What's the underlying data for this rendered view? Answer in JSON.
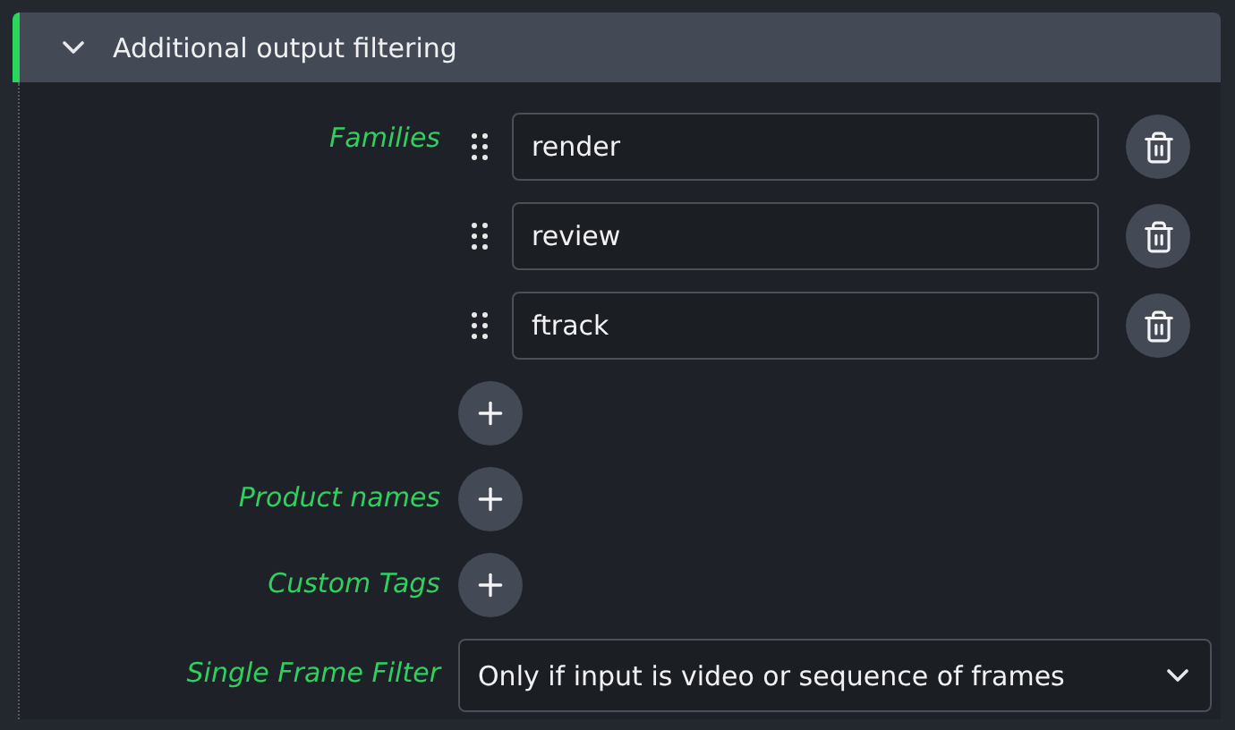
{
  "section": {
    "title": "Additional output filtering",
    "expanded": true
  },
  "fields": [
    {
      "kind": "list",
      "label": "Families",
      "items": [
        "render",
        "review",
        "ftrack"
      ]
    },
    {
      "kind": "list",
      "label": "Product names"
    },
    {
      "kind": "list",
      "label": "Custom Tags"
    },
    {
      "kind": "select",
      "label": "Single Frame Filter",
      "value": "Only if input is video or sequence of frames"
    }
  ]
}
